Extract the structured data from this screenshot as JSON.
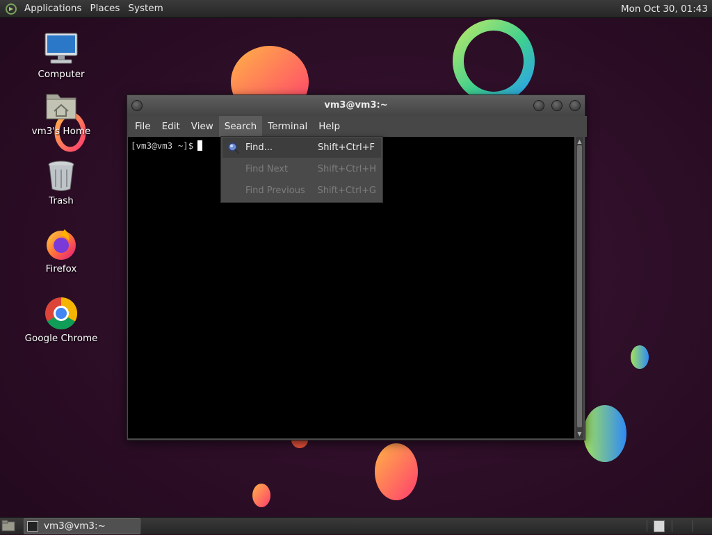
{
  "top_panel": {
    "menus": [
      "Applications",
      "Places",
      "System"
    ],
    "clock": "Mon Oct 30, 01:43"
  },
  "desktop": {
    "icons": [
      {
        "label": "Computer",
        "icon": "computer-icon"
      },
      {
        "label": "vm3's Home",
        "icon": "home-folder-icon"
      },
      {
        "label": "Trash",
        "icon": "trash-icon"
      },
      {
        "label": "Firefox",
        "icon": "firefox-icon"
      },
      {
        "label": "Google Chrome",
        "icon": "chrome-icon"
      }
    ]
  },
  "terminal": {
    "title": "vm3@vm3:~",
    "menubar": [
      "File",
      "Edit",
      "View",
      "Search",
      "Terminal",
      "Help"
    ],
    "active_menu": "Search",
    "prompt": "[vm3@vm3 ~]$"
  },
  "search_menu": {
    "items": [
      {
        "label": "Find...",
        "accel": "Shift+Ctrl+F",
        "enabled": true
      },
      {
        "label": "Find Next",
        "accel": "Shift+Ctrl+H",
        "enabled": false
      },
      {
        "label": "Find Previous",
        "accel": "Shift+Ctrl+G",
        "enabled": false
      }
    ]
  },
  "taskbar": {
    "tasks": [
      {
        "label": "vm3@vm3:~"
      }
    ]
  },
  "colors": {
    "wallpaper_bg": "#2a0f24",
    "panel_bg": "#303030",
    "menu_active": "#5c5c5c",
    "terminal_bg": "#000000"
  }
}
